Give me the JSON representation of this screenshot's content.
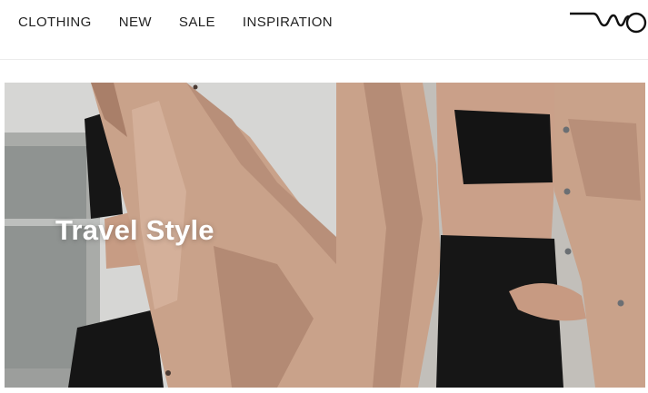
{
  "nav": {
    "items": [
      {
        "label": "CLOTHING"
      },
      {
        "label": "NEW"
      },
      {
        "label": "SALE"
      },
      {
        "label": "INSPIRATION"
      }
    ]
  },
  "brand": {
    "logo_icon": "mo-script-logo-icon"
  },
  "hero": {
    "title": "Travel Style",
    "colors": {
      "shirt": "#c9a28a",
      "shirt_shadow": "#a97f69",
      "black": "#161616",
      "skin": "#caa089"
    }
  }
}
